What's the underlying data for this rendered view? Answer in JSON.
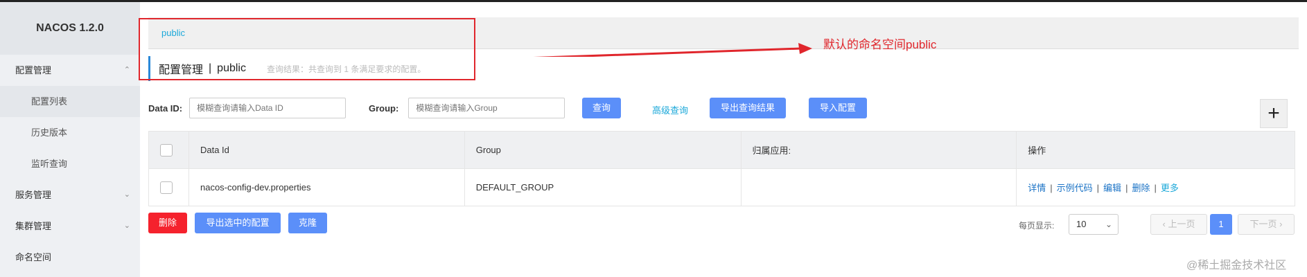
{
  "sidebar": {
    "brand": "NACOS 1.2.0",
    "items": [
      {
        "label": "配置管理",
        "chevron": "^"
      },
      {
        "label": "配置列表"
      },
      {
        "label": "历史版本"
      },
      {
        "label": "监听查询"
      },
      {
        "label": "服务管理",
        "chevron": "v"
      },
      {
        "label": "集群管理",
        "chevron": "v"
      },
      {
        "label": "命名空间"
      }
    ]
  },
  "breadcrumb": {
    "namespace_link": "public"
  },
  "title": {
    "main": "配置管理",
    "separator": "|",
    "namespace": "public",
    "result": "查询结果：共查询到 1 条满足要求的配置。"
  },
  "annotation": {
    "text": "默认的命名空间public"
  },
  "filters": {
    "data_id_label": "Data ID:",
    "data_id_placeholder": "模糊查询请输入Data ID",
    "group_label": "Group:",
    "group_placeholder": "模糊查询请输入Group"
  },
  "toolbar": {
    "query": "查询",
    "advanced_query": "高级查询",
    "export_results": "导出查询结果",
    "import_config": "导入配置",
    "add": "+"
  },
  "table": {
    "headers": [
      "Data Id",
      "Group",
      "归属应用:",
      "操作"
    ],
    "rows": [
      {
        "data_id": "nacos-config-dev.properties",
        "group": "DEFAULT_GROUP",
        "app": ""
      }
    ],
    "ops": {
      "detail": "详情",
      "sample": "示例代码",
      "edit": "编辑",
      "delete": "删除",
      "more": "更多",
      "sep": "|"
    }
  },
  "bulk": {
    "delete": "删除",
    "export_selected": "导出选中的配置",
    "clone": "克隆"
  },
  "pagination": {
    "per_page_label": "每页显示:",
    "per_page_value": "10",
    "prev": "上一页",
    "next": "下一页",
    "current_page": "1"
  },
  "watermark": "@稀土掘金技术社区"
}
